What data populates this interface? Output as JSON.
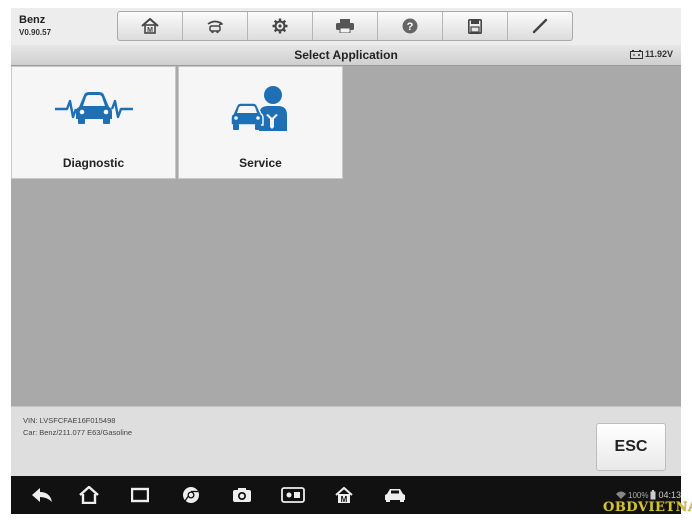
{
  "app": {
    "title": "Benz",
    "version": "V0.90.57"
  },
  "toolbar": {
    "items": [
      {
        "name": "home-icon"
      },
      {
        "name": "vehicle-swap-icon"
      },
      {
        "name": "settings-icon"
      },
      {
        "name": "print-icon"
      },
      {
        "name": "help-icon"
      },
      {
        "name": "save-icon"
      },
      {
        "name": "pen-icon"
      }
    ]
  },
  "titlebar": {
    "title": "Select Application",
    "voltage": "11.92V"
  },
  "tiles": [
    {
      "label": "Diagnostic",
      "icon": "car-heartbeat-icon"
    },
    {
      "label": "Service",
      "icon": "car-technician-icon"
    }
  ],
  "footer": {
    "vin": "VIN: LVSFCFAE16F015498",
    "car": "Car: Benz/211.077 E63/Gasoline",
    "esc_label": "ESC"
  },
  "navbar": {
    "items": [
      "back-icon",
      "home-icon",
      "recent-apps-icon",
      "browser-icon",
      "camera-icon",
      "screen-icon",
      "maxisys-icon",
      "car-icon"
    ],
    "battery": "100%",
    "time": "04:13"
  },
  "watermark": "OBDVIETNAM",
  "colors": {
    "accent_blue": "#1f6fb5",
    "background": "#a9a9a9"
  }
}
